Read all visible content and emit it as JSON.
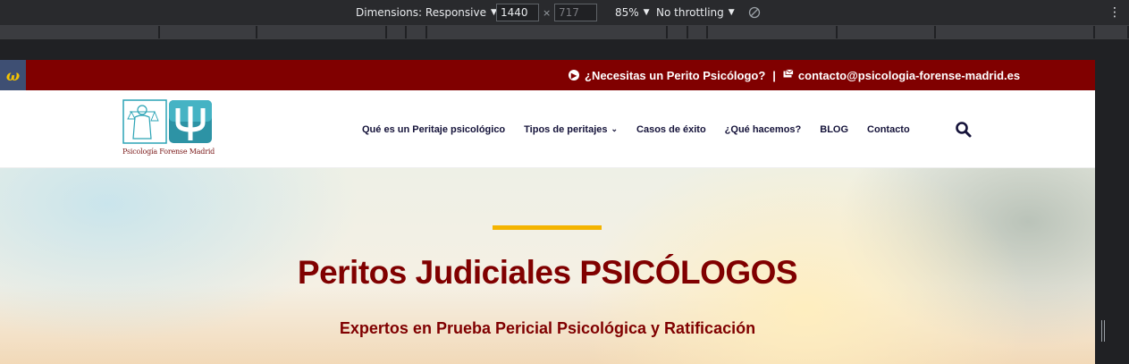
{
  "devtools": {
    "dimensions_label": "Dimensions: Responsive",
    "width_value": "1440",
    "height_placeholder": "717",
    "times": "×",
    "zoom": "85%",
    "throttling": "No throttling",
    "caret": "▼"
  },
  "topbar": {
    "badge": "ω",
    "question": "¿Necesitas un Perito Psicólogo?",
    "separator": "|",
    "email": "contacto@psicologia-forense-madrid.es"
  },
  "logo": {
    "caption": "Psicología Forense Madrid"
  },
  "nav": {
    "items": [
      {
        "label": "Qué es un Peritaje psicológico"
      },
      {
        "label": "Tipos de peritajes"
      },
      {
        "label": "Casos de éxito"
      },
      {
        "label": "¿Qué hacemos?"
      },
      {
        "label": "BLOG"
      },
      {
        "label": "Contacto"
      }
    ]
  },
  "hero": {
    "title": "Peritos Judiciales PSICÓLOGOS",
    "subtitle": "Expertos en Prueba Pericial Psicológica y Ratificación"
  },
  "colors": {
    "brand": "#800000",
    "accent": "#f4b400",
    "nav_text": "#15133a",
    "logo_teal": "#2aa3b5"
  },
  "icons": {
    "topbar_question": "chevron-circle-icon",
    "topbar_email": "envelope-icon",
    "nav_search": "search-icon",
    "nav_dropdown": "chevron-down-icon"
  }
}
